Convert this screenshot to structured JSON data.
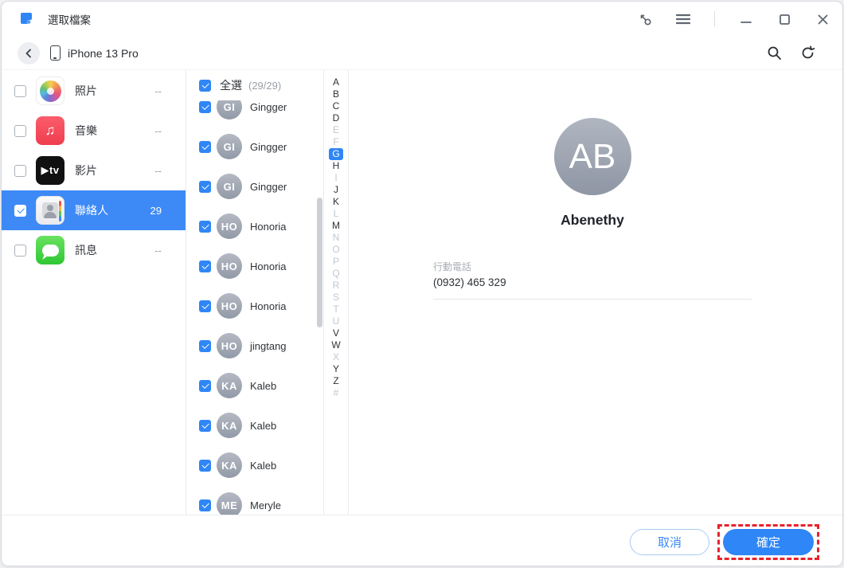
{
  "window": {
    "title": "選取檔案",
    "controls": [
      "key-icon",
      "menu-icon",
      "minimize-icon",
      "maximize-icon",
      "close-icon"
    ]
  },
  "header": {
    "device_name": "iPhone 13 Pro",
    "tools": [
      "search-icon",
      "refresh-icon"
    ]
  },
  "sidebar": {
    "items": [
      {
        "label": "照片",
        "count": "--",
        "icon": "photos-app-icon",
        "checked": false,
        "selected": false
      },
      {
        "label": "音樂",
        "count": "--",
        "icon": "music-app-icon",
        "checked": false,
        "selected": false
      },
      {
        "label": "影片",
        "count": "--",
        "icon": "tv-app-icon",
        "checked": false,
        "selected": false
      },
      {
        "label": "聯絡人",
        "count": "29",
        "icon": "contacts-app-icon",
        "checked": true,
        "selected": true
      },
      {
        "label": "訊息",
        "count": "--",
        "icon": "messages-app-icon",
        "checked": false,
        "selected": false
      }
    ]
  },
  "contact_list": {
    "select_all_label": "全選",
    "select_all_count": "(29/29)",
    "contacts": [
      {
        "initials": "GI",
        "name": "Gingger",
        "checked": true
      },
      {
        "initials": "GI",
        "name": "Gingger",
        "checked": true
      },
      {
        "initials": "GI",
        "name": "Gingger",
        "checked": true
      },
      {
        "initials": "HO",
        "name": "Honoria",
        "checked": true
      },
      {
        "initials": "HO",
        "name": "Honoria",
        "checked": true
      },
      {
        "initials": "HO",
        "name": "Honoria",
        "checked": true
      },
      {
        "initials": "HO",
        "name": "jingtang",
        "checked": true
      },
      {
        "initials": "KA",
        "name": "Kaleb",
        "checked": true
      },
      {
        "initials": "KA",
        "name": "Kaleb",
        "checked": true
      },
      {
        "initials": "KA",
        "name": "Kaleb",
        "checked": true
      },
      {
        "initials": "ME",
        "name": "Meryle",
        "checked": true
      }
    ]
  },
  "alphabet": {
    "letters": [
      {
        "ch": "A",
        "state": "on"
      },
      {
        "ch": "B",
        "state": "on"
      },
      {
        "ch": "C",
        "state": "on"
      },
      {
        "ch": "D",
        "state": "on"
      },
      {
        "ch": "E",
        "state": "off"
      },
      {
        "ch": "F",
        "state": "off"
      },
      {
        "ch": "G",
        "state": "active"
      },
      {
        "ch": "H",
        "state": "on"
      },
      {
        "ch": "I",
        "state": "off"
      },
      {
        "ch": "J",
        "state": "on"
      },
      {
        "ch": "K",
        "state": "on"
      },
      {
        "ch": "L",
        "state": "off"
      },
      {
        "ch": "M",
        "state": "on"
      },
      {
        "ch": "N",
        "state": "off"
      },
      {
        "ch": "O",
        "state": "off"
      },
      {
        "ch": "P",
        "state": "off"
      },
      {
        "ch": "Q",
        "state": "off"
      },
      {
        "ch": "R",
        "state": "off"
      },
      {
        "ch": "S",
        "state": "off"
      },
      {
        "ch": "T",
        "state": "off"
      },
      {
        "ch": "U",
        "state": "off"
      },
      {
        "ch": "V",
        "state": "on"
      },
      {
        "ch": "W",
        "state": "on"
      },
      {
        "ch": "X",
        "state": "off"
      },
      {
        "ch": "Y",
        "state": "on"
      },
      {
        "ch": "Z",
        "state": "on"
      },
      {
        "ch": "#",
        "state": "off"
      }
    ]
  },
  "detail": {
    "initials": "AB",
    "name": "Abenethy",
    "fields": [
      {
        "label": "行動電話",
        "value": "(0932) 465 329"
      }
    ]
  },
  "footer": {
    "cancel_label": "取消",
    "confirm_label": "確定"
  },
  "colors": {
    "accent": "#2f86f6",
    "selected_row": "#3d8af7",
    "annotation_red": "#e8222a",
    "avatar_gray": "#9aa0ac"
  }
}
